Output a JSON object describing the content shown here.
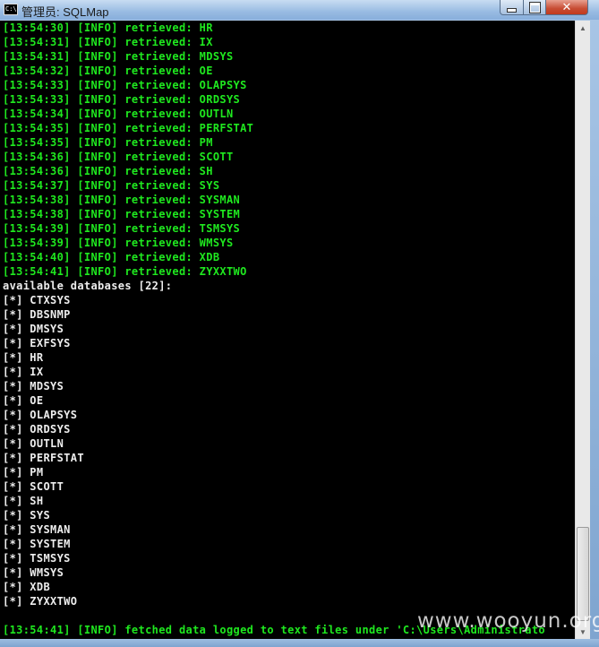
{
  "window": {
    "title": "管理员: SQLMap",
    "icon": "cmd-icon",
    "icon_text": "C:\\",
    "minimize": "minimize-icon",
    "maximize": "maximize-icon",
    "close": "close-icon",
    "close_glyph": "✕"
  },
  "console": {
    "retrieved_lines": [
      "[13:54:30] [INFO] retrieved: HR",
      "[13:54:31] [INFO] retrieved: IX",
      "[13:54:31] [INFO] retrieved: MDSYS",
      "[13:54:32] [INFO] retrieved: OE",
      "[13:54:33] [INFO] retrieved: OLAPSYS",
      "[13:54:33] [INFO] retrieved: ORDSYS",
      "[13:54:34] [INFO] retrieved: OUTLN",
      "[13:54:35] [INFO] retrieved: PERFSTAT",
      "[13:54:35] [INFO] retrieved: PM",
      "[13:54:36] [INFO] retrieved: SCOTT",
      "[13:54:36] [INFO] retrieved: SH",
      "[13:54:37] [INFO] retrieved: SYS",
      "[13:54:38] [INFO] retrieved: SYSMAN",
      "[13:54:38] [INFO] retrieved: SYSTEM",
      "[13:54:39] [INFO] retrieved: TSMSYS",
      "[13:54:39] [INFO] retrieved: WMSYS",
      "[13:54:40] [INFO] retrieved: XDB",
      "[13:54:41] [INFO] retrieved: ZYXXTWO"
    ],
    "available_header": "available databases [22]:",
    "databases": [
      "[*] CTXSYS",
      "[*] DBSNMP",
      "[*] DMSYS",
      "[*] EXFSYS",
      "[*] HR",
      "[*] IX",
      "[*] MDSYS",
      "[*] OE",
      "[*] OLAPSYS",
      "[*] ORDSYS",
      "[*] OUTLN",
      "[*] PERFSTAT",
      "[*] PM",
      "[*] SCOTT",
      "[*] SH",
      "[*] SYS",
      "[*] SYSMAN",
      "[*] SYSTEM",
      "[*] TSMSYS",
      "[*] WMSYS",
      "[*] XDB",
      "[*] ZYXXTWO"
    ],
    "final_line": "[13:54:41] [INFO] fetched data logged to text files under 'C:\\Users\\Administrato"
  },
  "scrollbar": {
    "up": "▲",
    "down": "▼"
  },
  "watermark": "www.wooyun.org",
  "colors": {
    "info_green": "#1fe81f",
    "text_white": "#ededed",
    "background": "#000000"
  }
}
